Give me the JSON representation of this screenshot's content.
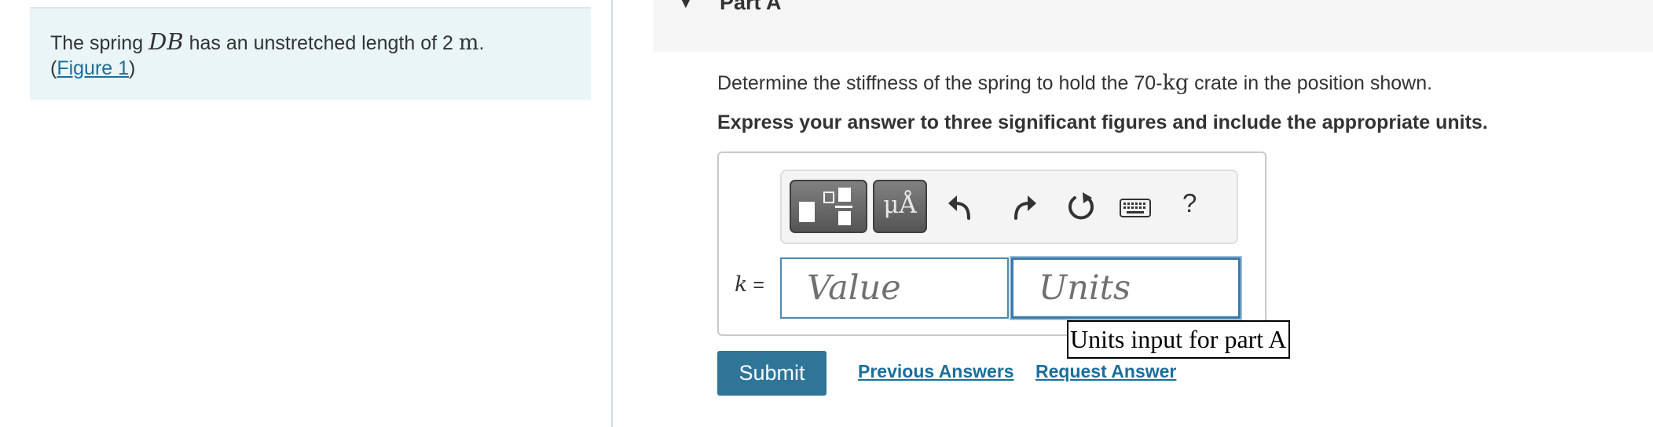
{
  "intro": {
    "text_before": "The spring ",
    "variable": "DB",
    "text_after": " has an unstretched length of 2 ",
    "unit": "m",
    "period": ".",
    "figure_open": "(",
    "figure_link": "Figure 1",
    "figure_close": ")"
  },
  "part": {
    "title": "Part A",
    "question_before": "Determine the stiffness of the spring to hold the 70-",
    "question_unit": "kg",
    "question_after": " crate in the position shown.",
    "instruction": "Express your answer to three significant figures and include the appropriate units."
  },
  "toolbar": {
    "units_glyph": "μÅ",
    "help_label": "?"
  },
  "answer": {
    "variable": "k",
    "equals": " =",
    "value_placeholder": "Value",
    "units_placeholder": "Units",
    "units_tooltip": "Units input for part A"
  },
  "actions": {
    "submit_label": "Submit",
    "previous_answers_label": "Previous Answers",
    "request_answer_label": "Request Answer"
  },
  "colors": {
    "accent": "#2f7598",
    "link": "#1b6e9c",
    "intro_bg": "#e9f5f7"
  },
  "icons": [
    "templates-icon",
    "units-icon",
    "undo-icon",
    "redo-icon",
    "reset-icon",
    "keyboard-icon",
    "help-icon"
  ]
}
